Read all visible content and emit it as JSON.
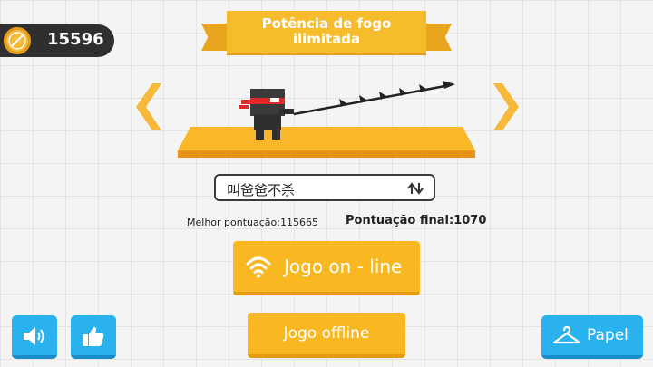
{
  "coins": {
    "count": "15596",
    "icon": "coin-icon"
  },
  "banner": {
    "title": "Potência de fogo ilimitada"
  },
  "character": {
    "name": "叫爸爸不杀"
  },
  "scores": {
    "best": "Melhor pontuação:115665",
    "final": "Pontuação final:1070"
  },
  "buttons": {
    "online": "Jogo on - line",
    "offline": "Jogo offline",
    "paper": "Papel"
  },
  "colors": {
    "accent_orange": "#f9b722",
    "button_blue": "#2ab2ee",
    "arrow_gold": "#f6b93a",
    "dark": "#2f2f2f"
  }
}
